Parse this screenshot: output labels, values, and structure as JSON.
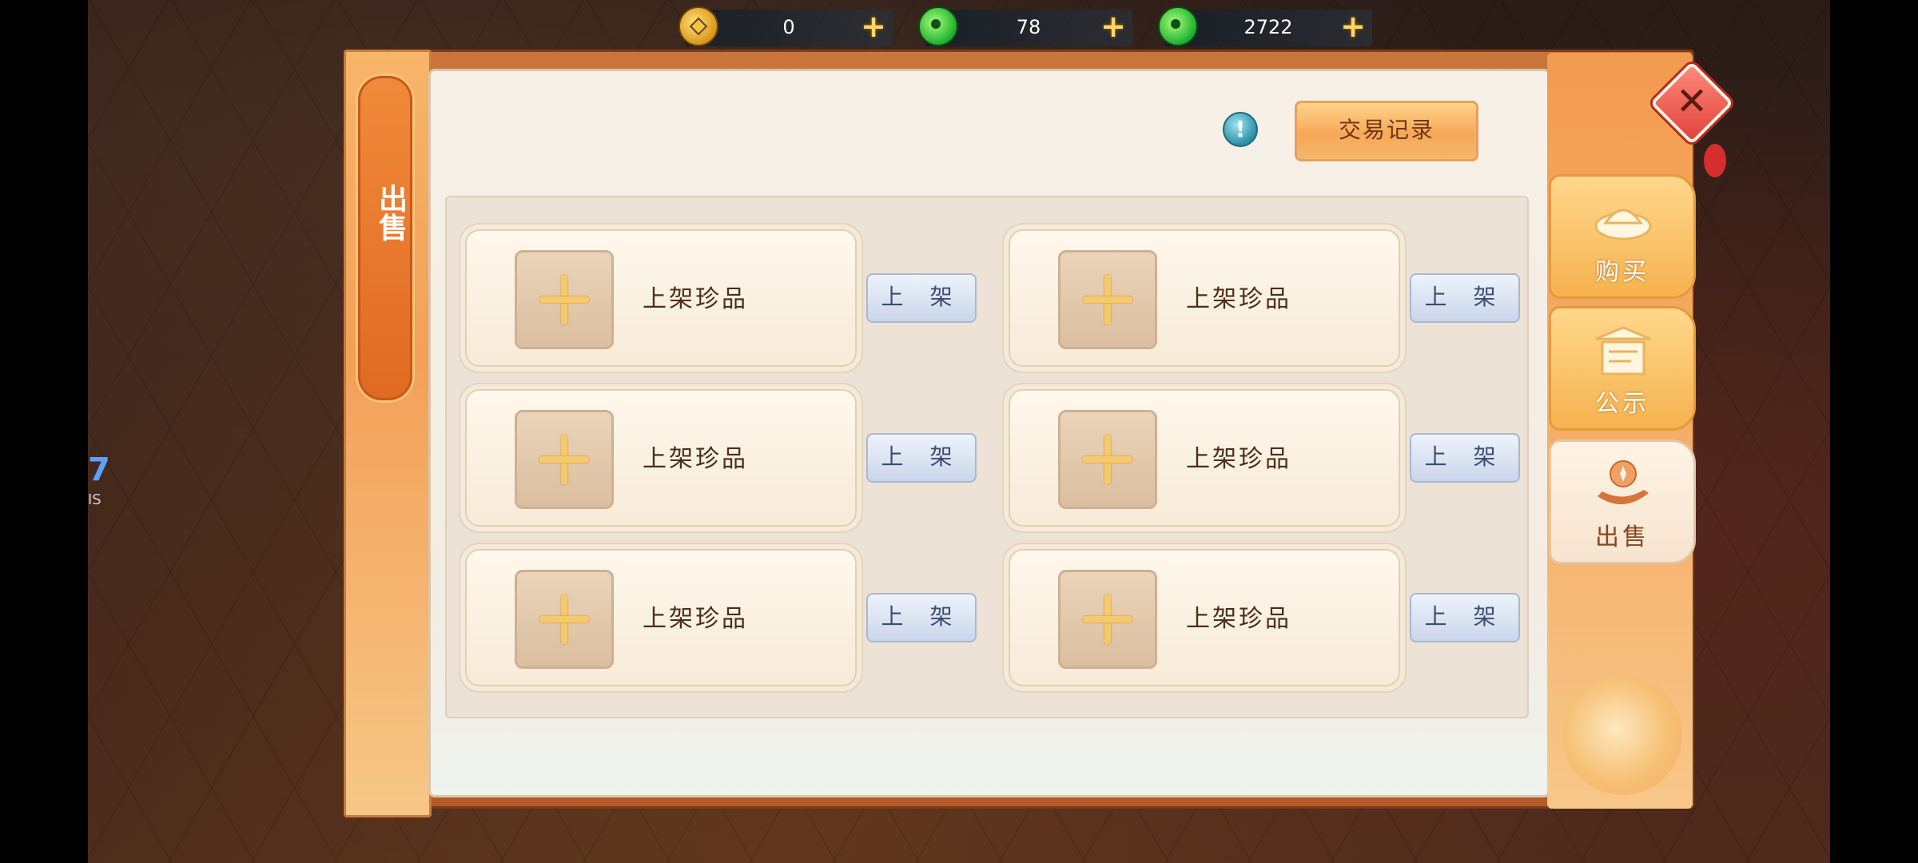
{
  "currencies": [
    {
      "name": "copper-coin",
      "icon": "coin-icon",
      "value": "0"
    },
    {
      "name": "jade",
      "icon": "jade-icon",
      "value": "78"
    },
    {
      "name": "bound-jade",
      "icon": "jade-icon",
      "value": "2722"
    }
  ],
  "left_tab": {
    "label": "出售"
  },
  "header": {
    "record_button": "交易记录",
    "info_icon": "info-icon"
  },
  "slots": [
    {
      "label": "上架珍品",
      "button": "上 架"
    },
    {
      "label": "上架珍品",
      "button": "上 架"
    },
    {
      "label": "上架珍品",
      "button": "上 架"
    },
    {
      "label": "上架珍品",
      "button": "上 架"
    },
    {
      "label": "上架珍品",
      "button": "上 架"
    },
    {
      "label": "上架珍品",
      "button": "上 架"
    }
  ],
  "right_tabs": [
    {
      "label": "购买",
      "icon": "ingot-icon",
      "active": false
    },
    {
      "label": "公示",
      "icon": "pavilion-board-icon",
      "active": false
    },
    {
      "label": "出售",
      "icon": "hand-coin-icon",
      "active": true
    }
  ],
  "side_stub": {
    "text1": "7",
    "text2": "IS"
  },
  "colors": {
    "accent": "#f5a058",
    "panel": "#f7f0e6",
    "button_blue": "#c9d6ea"
  }
}
